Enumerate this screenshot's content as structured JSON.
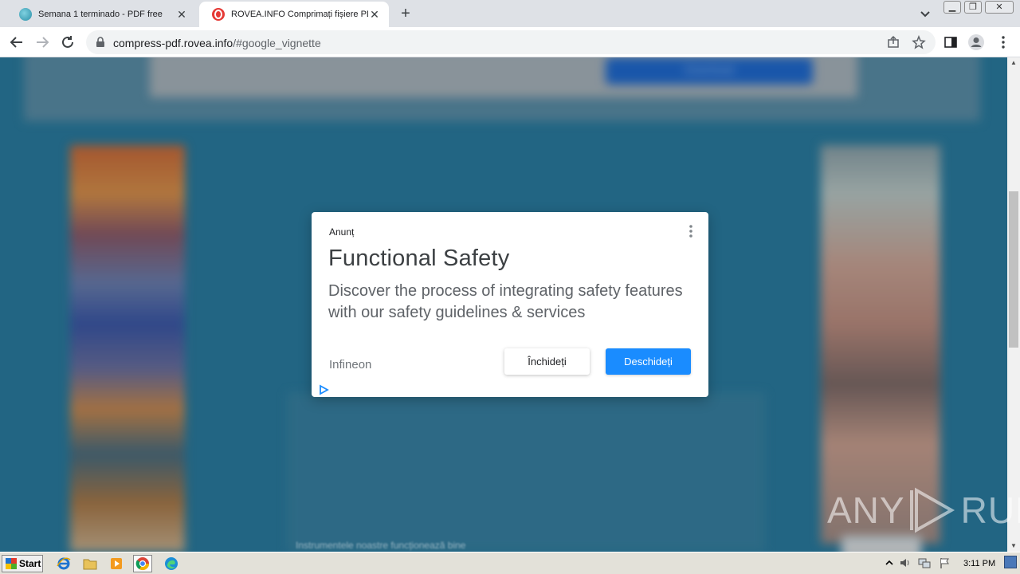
{
  "browser": {
    "tabs": [
      {
        "title": "Semana 1 terminado - PDF free",
        "active": false
      },
      {
        "title": "ROVEA.INFO Comprimați fișiere PDF",
        "active": true
      }
    ],
    "new_tab_label": "+",
    "url_host": "compress-pdf.rovea.info",
    "url_path": "/#google_vignette"
  },
  "ad": {
    "label": "Anunț",
    "title": "Functional Safety",
    "description": "Discover the process of integrating safety features with our safety guidelines & services",
    "advertiser": "Infineon",
    "close_button": "Închideți",
    "open_button": "Deschideți",
    "accent_color": "#1a8cff"
  },
  "page": {
    "bottom_text": "Instrumentele noastre funcționează bine",
    "behind_button": "Download"
  },
  "watermark": {
    "left": "ANY",
    "right": "RUN"
  },
  "taskbar": {
    "start_label": "Start",
    "clock": "3:11 PM",
    "apps": [
      "ie-icon",
      "explorer-icon",
      "media-player-icon",
      "chrome-icon",
      "edge-icon"
    ]
  }
}
